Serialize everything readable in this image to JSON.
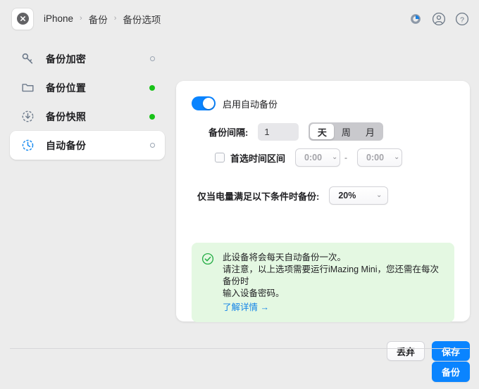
{
  "window": {
    "close_icon": "close-circle-icon"
  },
  "breadcrumb": {
    "items": [
      {
        "label": "iPhone"
      },
      {
        "label": "备份"
      },
      {
        "label": "备份选项"
      }
    ],
    "separator": "›"
  },
  "topbar_icons": [
    {
      "name": "sync-progress-icon"
    },
    {
      "name": "account-icon"
    },
    {
      "name": "help-icon"
    }
  ],
  "sidebar": {
    "items": [
      {
        "label": "备份加密",
        "icon": "key-icon",
        "status": "hollow",
        "selected": false
      },
      {
        "label": "备份位置",
        "icon": "folder-icon",
        "status": "green",
        "selected": false
      },
      {
        "label": "备份快照",
        "icon": "download-clock-icon",
        "status": "green",
        "selected": false
      },
      {
        "label": "自动备份",
        "icon": "clock-icon",
        "status": "hollow",
        "selected": true
      }
    ]
  },
  "main": {
    "auto_backup_toggle": {
      "label": "启用自动备份",
      "on": true
    },
    "interval": {
      "label": "备份间隔:",
      "value": "1",
      "units": [
        {
          "label": "天",
          "selected": true
        },
        {
          "label": "周",
          "selected": false
        },
        {
          "label": "月",
          "selected": false
        }
      ]
    },
    "preferred_time": {
      "label": "首选时间区间",
      "checked": false,
      "from": "0:00",
      "to": "0:00",
      "dash": "-",
      "caret": "⌄"
    },
    "battery": {
      "label": "仅当电量满足以下条件时备份:",
      "value": "20%",
      "caret": "⌄"
    },
    "info": {
      "icon": "check-circle-icon",
      "line1": "此设备将会每天自动备份一次。",
      "line2": "请注意，以上选项需要运行iMazing Mini，您还需在每次备份时",
      "line3": "输入设备密码。",
      "link": "了解详情 →"
    }
  },
  "actions": {
    "discard_label": "丢弃",
    "save_label": "保存"
  },
  "footer": {
    "backup_label": "备份"
  },
  "colors": {
    "accent": "#0a84ff",
    "status_green": "#18c218",
    "info_bg": "#e4f8e2",
    "info_check": "#27ae47",
    "window_bg": "#ececec",
    "card_bg": "#ffffff",
    "link": "#1384e8"
  }
}
